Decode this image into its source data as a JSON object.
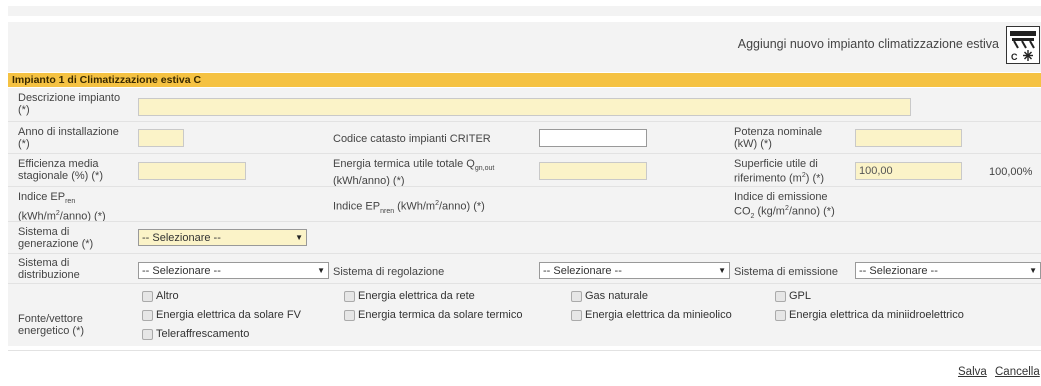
{
  "header": {
    "add_label": "Aggiungi nuovo impianto climatizzazione estiva",
    "add_icon_caption": "C"
  },
  "section": {
    "title": "Impianto 1 di Climatizzazione estiva C"
  },
  "fields": {
    "descrizione": {
      "label_main": "Descrizione impianto",
      "label_req": "(*)",
      "value": ""
    },
    "anno": {
      "label_main": "Anno di installazione",
      "label_req": "(*)",
      "value": ""
    },
    "criter": {
      "label": "Codice catasto impianti CRITER",
      "value": ""
    },
    "potenza": {
      "label_main": "Potenza nominale",
      "label_sub": "(kW) (*)",
      "value": ""
    },
    "efficienza": {
      "label_main": "Efficienza media",
      "label_sub": "stagionale (%) (*)",
      "value": ""
    },
    "energia_termica": {
      "label_main": "Energia termica utile totale Q",
      "label_subscript": "gn,out",
      "label_sub": "(kWh/anno) (*)",
      "value": ""
    },
    "superficie": {
      "label_main": "Superficie utile di",
      "label_sub_a": "riferimento (m",
      "label_sup": "2",
      "label_sub_b": ") (*)",
      "value": "100,00",
      "percent": "100,00%"
    },
    "ep_ren": {
      "label_a": "Indice EP",
      "label_subscript": "ren",
      "label_b": "(kWh/m",
      "label_sup": "2",
      "label_c": "/anno) (*)"
    },
    "ep_nren": {
      "label_a": "Indice EP",
      "label_subscript": "nren",
      "label_b": " (kWh/m",
      "label_sup": "2",
      "label_c": "/anno) (*)"
    },
    "co2": {
      "label_a": "Indice di emissione",
      "label_b": "CO",
      "label_subscript": "2",
      "label_c": " (kg/m",
      "label_sup": "2",
      "label_d": "/anno) (*)"
    },
    "generazione": {
      "label_main": "Sistema di",
      "label_sub": "generazione (*)",
      "selected": "-- Selezionare --"
    },
    "distribuzione": {
      "label_main": "Sistema di",
      "label_sub": "distribuzione",
      "selected": "-- Selezionare --"
    },
    "regolazione": {
      "label": "Sistema di regolazione",
      "selected": "-- Selezionare --"
    },
    "emissione": {
      "label": "Sistema di emissione",
      "selected": "-- Selezionare --"
    },
    "fonte": {
      "label_main": "Fonte/vettore",
      "label_sub": "energetico (*)"
    }
  },
  "fonti": [
    "Altro",
    "Energia elettrica da rete",
    "Gas naturale",
    "GPL",
    "Energia elettrica da solare FV",
    "Energia termica da solare termico",
    "Energia elettrica da minieolico",
    "Energia elettrica da miniidroelettrico",
    "Teleraffrescamento"
  ],
  "actions": {
    "save": "Salva",
    "cancel": "Cancella"
  }
}
